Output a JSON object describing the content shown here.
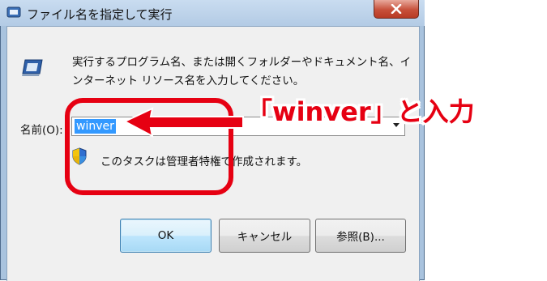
{
  "window": {
    "title": "ファイル名を指定して実行",
    "close_icon": "close-icon"
  },
  "dialog": {
    "description": "実行するプログラム名、または開くフォルダーやドキュメント名、インターネット リソース名を入力してください。",
    "name_label": "名前(O):",
    "name_value": "winver",
    "admin_note": "このタスクは管理者特権で作成されます。"
  },
  "buttons": {
    "ok": "OK",
    "cancel": "キャンセル",
    "browse": "参照(B)..."
  },
  "annotation": {
    "text": "「winver」と入力",
    "color": "#e60012"
  },
  "icons": [
    "run-icon",
    "shield-icon",
    "close-icon"
  ]
}
